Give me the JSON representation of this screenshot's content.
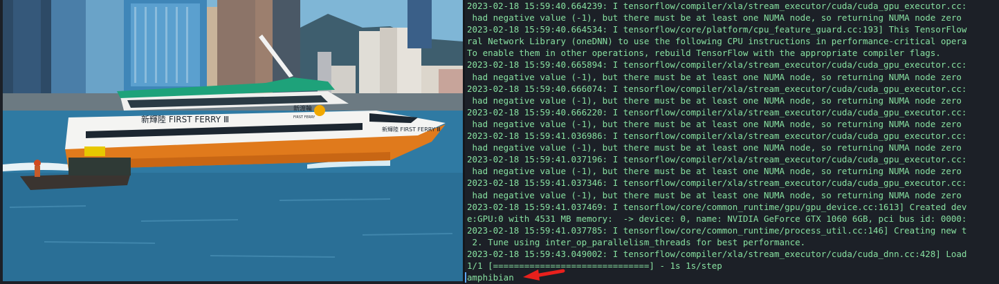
{
  "photo": {
    "ferry_name": "新輝陸 FIRST FERRY Ⅲ",
    "ferry_bow_name": "新輝陸 FIRST FERRY Ⅲ",
    "ferry_logo_text": "新渡輪",
    "ferry_logo_sub": "FIRST FERRY"
  },
  "terminal": {
    "lines": [
      "2023-02-18 15:59:40.664239: I tensorflow/compiler/xla/stream_executor/cuda/cuda_gpu_executor.cc:",
      " had negative value (-1), but there must be at least one NUMA node, so returning NUMA node zero",
      "2023-02-18 15:59:40.664534: I tensorflow/core/platform/cpu_feature_guard.cc:193] This TensorFlow",
      "ral Network Library (oneDNN) to use the following CPU instructions in performance-critical opera",
      "To enable them in other operations, rebuild TensorFlow with the appropriate compiler flags.",
      "2023-02-18 15:59:40.665894: I tensorflow/compiler/xla/stream_executor/cuda/cuda_gpu_executor.cc:",
      " had negative value (-1), but there must be at least one NUMA node, so returning NUMA node zero",
      "2023-02-18 15:59:40.666074: I tensorflow/compiler/xla/stream_executor/cuda/cuda_gpu_executor.cc:",
      " had negative value (-1), but there must be at least one NUMA node, so returning NUMA node zero",
      "2023-02-18 15:59:40.666220: I tensorflow/compiler/xla/stream_executor/cuda/cuda_gpu_executor.cc:",
      " had negative value (-1), but there must be at least one NUMA node, so returning NUMA node zero",
      "2023-02-18 15:59:41.036986: I tensorflow/compiler/xla/stream_executor/cuda/cuda_gpu_executor.cc:",
      " had negative value (-1), but there must be at least one NUMA node, so returning NUMA node zero",
      "2023-02-18 15:59:41.037196: I tensorflow/compiler/xla/stream_executor/cuda/cuda_gpu_executor.cc:",
      " had negative value (-1), but there must be at least one NUMA node, so returning NUMA node zero",
      "2023-02-18 15:59:41.037346: I tensorflow/compiler/xla/stream_executor/cuda/cuda_gpu_executor.cc:",
      " had negative value (-1), but there must be at least one NUMA node, so returning NUMA node zero",
      "2023-02-18 15:59:41.037469: I tensorflow/core/common_runtime/gpu/gpu_device.cc:1613] Created dev",
      "e:GPU:0 with 4531 MB memory:  -> device: 0, name: NVIDIA GeForce GTX 1060 6GB, pci bus id: 0000:",
      "2023-02-18 15:59:41.037785: I tensorflow/core/common_runtime/process_util.cc:146] Creating new t",
      " 2. Tune using inter_op_parallelism_threads for best performance.",
      "2023-02-18 15:59:43.049002: I tensorflow/compiler/xla/stream_executor/cuda/cuda_dnn.cc:428] Load",
      "1/1 [==============================] - 1s 1s/step"
    ],
    "prediction": "amphibian",
    "text_color": "#87e0a0",
    "background_color": "#1c2027"
  },
  "annotation": {
    "arrow_color": "#e8201c",
    "icon": "red-arrow-icon"
  }
}
